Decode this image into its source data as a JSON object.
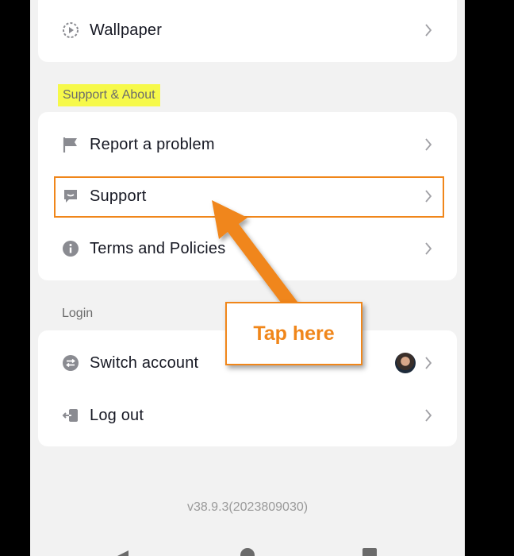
{
  "settings": {
    "top_items": [
      {
        "label": "Wallpaper",
        "icon": "wallpaper-icon"
      }
    ],
    "support_section": {
      "title": "Support & About",
      "items": [
        {
          "label": "Report a problem",
          "icon": "flag-icon"
        },
        {
          "label": "Support",
          "icon": "support-chat-icon"
        },
        {
          "label": "Terms and Policies",
          "icon": "info-icon"
        }
      ]
    },
    "login_section": {
      "title": "Login",
      "items": [
        {
          "label": "Switch account",
          "icon": "switch-account-icon"
        },
        {
          "label": "Log out",
          "icon": "logout-icon"
        }
      ]
    },
    "version": "v38.9.3(2023809030)"
  },
  "annotation": {
    "callout_text": "Tap here",
    "accent_color": "#f0861a",
    "highlight_color": "#f6f94a"
  }
}
